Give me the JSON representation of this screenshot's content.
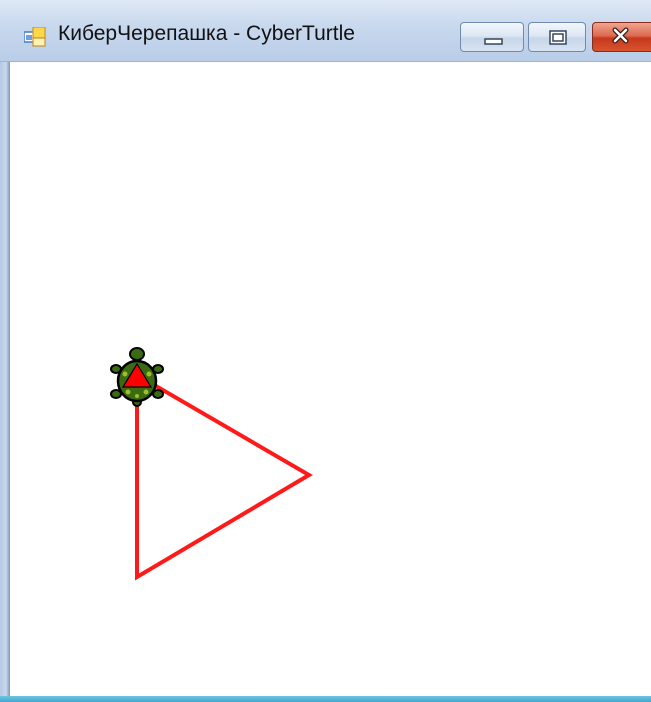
{
  "window": {
    "title": "КиберЧерепашка - CyberTurtle"
  },
  "controls": {
    "minimize_icon": "minimize-icon",
    "maximize_icon": "maximize-icon",
    "close_icon": "close-icon"
  },
  "drawing": {
    "line_color": "#ff1a1a",
    "turtle_body_color": "#3a6b12",
    "turtle_marker_color": "#ff0000"
  }
}
